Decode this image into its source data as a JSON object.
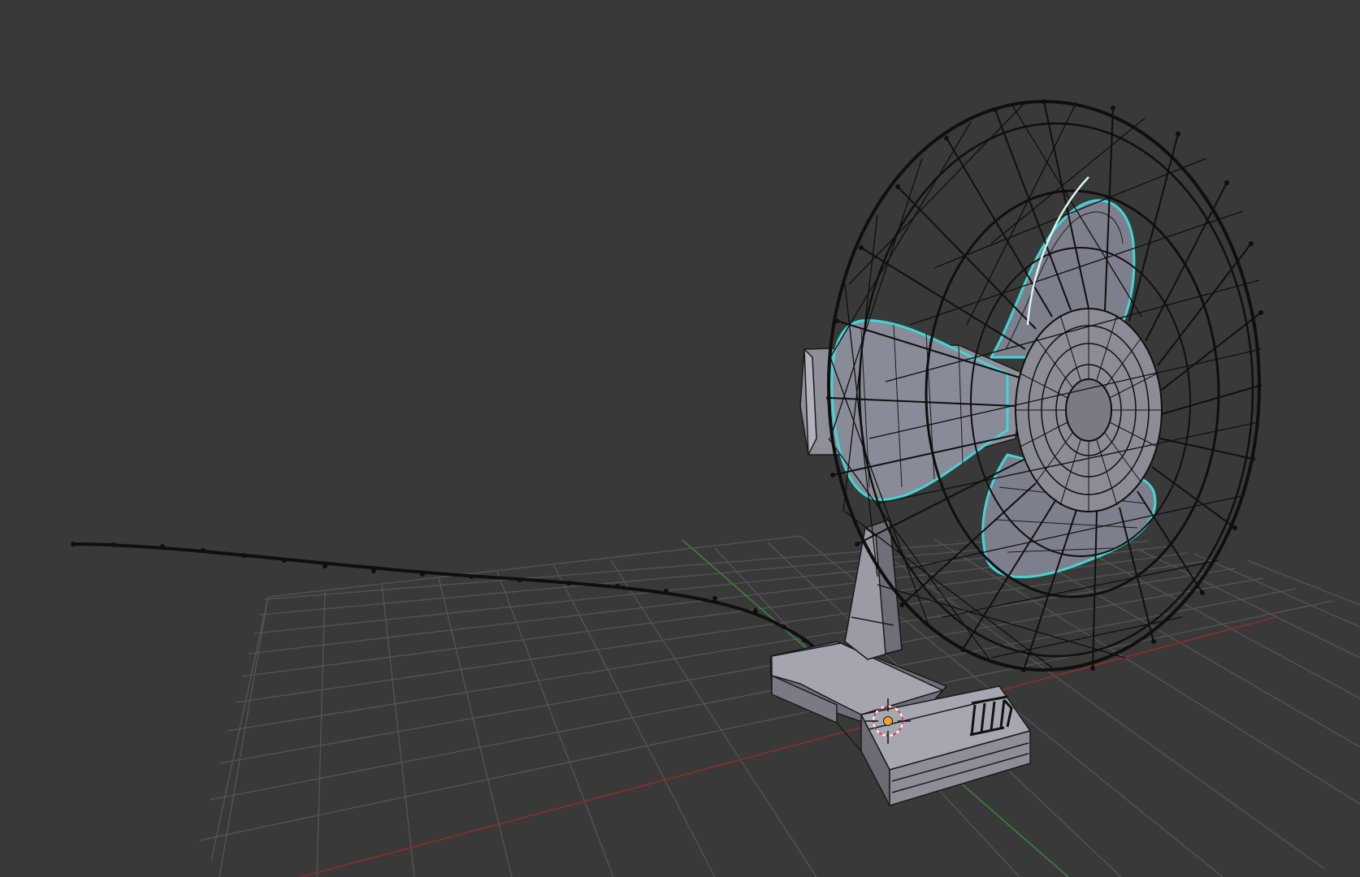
{
  "viewport": {
    "mode": "3D View",
    "background": "#393939",
    "colors": {
      "grid": "#555555",
      "x_axis": "#8a2d2d",
      "y_axis": "#3f7f3f",
      "wire": "#0f0f0f",
      "body": "#8e8e98",
      "body_light": "#a9a9b3",
      "body_dark": "#6b6b74",
      "blade": "#7e7f8c",
      "selection": "#42d6d6",
      "cursor_red": "#e03c3c",
      "origin": "#f0a030"
    },
    "icons": [
      "3d-cursor-icon",
      "object-origin-icon"
    ],
    "objects": [
      "grid-floor",
      "fan-grille",
      "fan-blades",
      "fan-hub",
      "fan-motor",
      "fan-neck",
      "fan-base",
      "fan-power-cord",
      "fan-control-buttons"
    ]
  }
}
